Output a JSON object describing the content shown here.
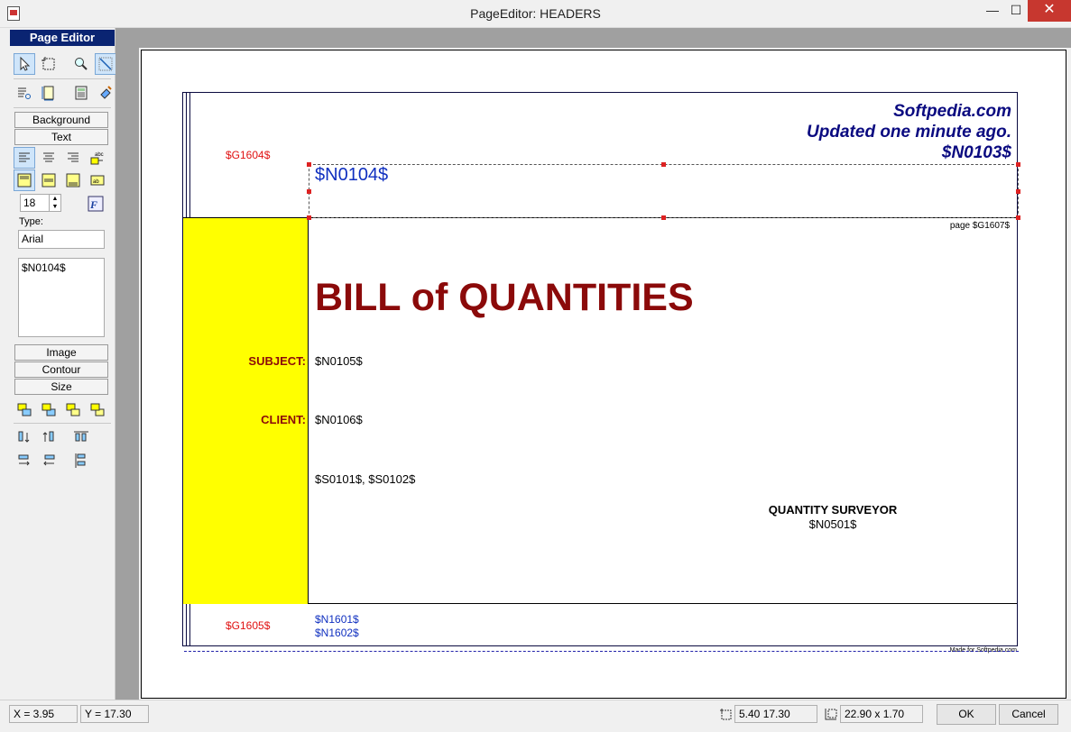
{
  "window": {
    "title": "PageEditor: HEADERS",
    "min": "—",
    "max": "☐",
    "close": "✕"
  },
  "panel": {
    "title": "Page Editor",
    "buttons": {
      "background": "Background",
      "text": "Text",
      "image": "Image",
      "contour": "Contour",
      "size": "Size"
    },
    "font_size": "18",
    "type_label": "Type:",
    "font_name": "Arial",
    "text_content": "$N0104$"
  },
  "document": {
    "header_left": "$G1604$",
    "header_line1": "Softpedia.com",
    "header_line2": "Updated one minute ago.",
    "header_line3": "$N0103$",
    "selected_text": "$N0104$",
    "page_label": "page $G1607$",
    "title": "BILL of QUANTITIES",
    "subject_label": "SUBJECT:",
    "subject_value": "$N0105$",
    "client_label": "CLIENT:",
    "client_value": "$N0106$",
    "s_values": "$S0101$, $S0102$",
    "qs_label": "QUANTITY SURVEYOR",
    "qs_value": "$N0501$",
    "footer_left": "$G1605$",
    "footer_line1": "$N1601$",
    "footer_line2": "$N1602$",
    "made_for": "Made for Softpedia.com"
  },
  "status": {
    "x": "X = 3.95",
    "y": "Y = 17.30",
    "pos": "5.40   17.30",
    "size": "22.90 x 1.70",
    "ok": "OK",
    "cancel": "Cancel"
  }
}
